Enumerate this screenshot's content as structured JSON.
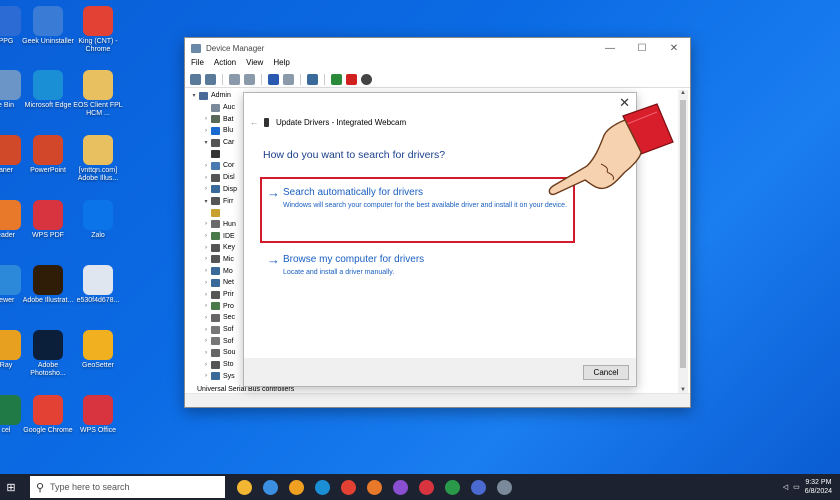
{
  "desktop": {
    "icons": [
      {
        "label": "PPG",
        "color": "#2d6bd4"
      },
      {
        "label": "Geek Uninstaller",
        "color": "#3a7bd5"
      },
      {
        "label": "King (CNT) - Chrome",
        "color": "#e34133"
      },
      {
        "label": "e Bin",
        "color": "#6b95c7"
      },
      {
        "label": "Microsoft Edge",
        "color": "#1b8fd6"
      },
      {
        "label": "EOS Client FPL HCM ...",
        "color": "#e8c060"
      },
      {
        "label": "aner",
        "color": "#d04a2a"
      },
      {
        "label": "PowerPoint",
        "color": "#d2472a"
      },
      {
        "label": "[vnttqn.com] Adobe Illus...",
        "color": "#e8c060"
      },
      {
        "label": "eader",
        "color": "#e8782a"
      },
      {
        "label": "WPS PDF",
        "color": "#d8343f"
      },
      {
        "label": "Zalo",
        "color": "#0a74e8"
      },
      {
        "label": "iewer",
        "color": "#2c88d9"
      },
      {
        "label": "Adobe Illustrat...",
        "color": "#2f1d08"
      },
      {
        "label": "e530f4d678...",
        "color": "#e0e6ef"
      },
      {
        "label": "Ray",
        "color": "#e8a020"
      },
      {
        "label": "Adobe Photosho...",
        "color": "#0b1e3a"
      },
      {
        "label": "GeoSetter",
        "color": "#f0b020"
      },
      {
        "label": "cel",
        "color": "#1f7a45"
      },
      {
        "label": "Google Chrome",
        "color": "#e34133"
      },
      {
        "label": "WPS Office",
        "color": "#d8343f"
      }
    ]
  },
  "device_manager": {
    "title": "Device Manager",
    "menu": [
      "File",
      "Action",
      "View",
      "Help"
    ],
    "tree": [
      {
        "arrow": "▾",
        "label": "Admin",
        "color": "#4a6a9a"
      },
      {
        "arrow": "",
        "label": "Auc",
        "color": "#7a8a9a"
      },
      {
        "arrow": "›",
        "label": "Bat",
        "color": "#5a6a5a"
      },
      {
        "arrow": "›",
        "label": "Blu",
        "color": "#1a6ad0"
      },
      {
        "arrow": "▾",
        "label": "Car",
        "color": "#555"
      },
      {
        "arrow": "",
        "label": "",
        "color": "#333"
      },
      {
        "arrow": "›",
        "label": "Cor",
        "color": "#4a7ab0"
      },
      {
        "arrow": "›",
        "label": "Disl",
        "color": "#555"
      },
      {
        "arrow": "›",
        "label": "Disp",
        "color": "#3a6a9a"
      },
      {
        "arrow": "▾",
        "label": "Firr",
        "color": "#555"
      },
      {
        "arrow": "",
        "label": "",
        "color": "#c8a030"
      },
      {
        "arrow": "›",
        "label": "Hun",
        "color": "#6a6a6a"
      },
      {
        "arrow": "›",
        "label": "IDE",
        "color": "#4a7a4a"
      },
      {
        "arrow": "›",
        "label": "Key",
        "color": "#555"
      },
      {
        "arrow": "›",
        "label": "Mic",
        "color": "#555"
      },
      {
        "arrow": "›",
        "label": "Mo",
        "color": "#3a6a9a"
      },
      {
        "arrow": "›",
        "label": "Net",
        "color": "#3a6a9a"
      },
      {
        "arrow": "›",
        "label": "Prir",
        "color": "#555"
      },
      {
        "arrow": "›",
        "label": "Pro",
        "color": "#4a7a4a"
      },
      {
        "arrow": "›",
        "label": "Sec",
        "color": "#666"
      },
      {
        "arrow": "›",
        "label": "Sof",
        "color": "#777"
      },
      {
        "arrow": "›",
        "label": "Sof",
        "color": "#777"
      },
      {
        "arrow": "›",
        "label": "Sou",
        "color": "#666"
      },
      {
        "arrow": "›",
        "label": "Sto",
        "color": "#555"
      },
      {
        "arrow": "›",
        "label": "Sys",
        "color": "#3a6a9a"
      }
    ],
    "bottom_item": "Universal Serial Bus controllers"
  },
  "dialog": {
    "close_glyph": "✕",
    "title": "Update Drivers - Integrated Webcam",
    "question": "How do you want to search for drivers?",
    "option_auto_title": "Search automatically for drivers",
    "option_auto_desc": "Windows will search your computer for the best available driver and install it on your device.",
    "option_browse_title": "Browse my computer for drivers",
    "option_browse_desc": "Locate and install a driver manually.",
    "cancel_label": "Cancel",
    "highlight_color": "#d11b2c"
  },
  "taskbar": {
    "search_placeholder": "Type here to search",
    "apps": [
      "#f2b632",
      "#3a8fe0",
      "#f0a020",
      "#1b8fd6",
      "#e34133",
      "#e8782a",
      "#8a4fd0",
      "#d8343f",
      "#2a9a4a",
      "#4a6ad0",
      "#7a8a9a"
    ],
    "time": "9:32 PM",
    "date": "6/8/2024"
  }
}
